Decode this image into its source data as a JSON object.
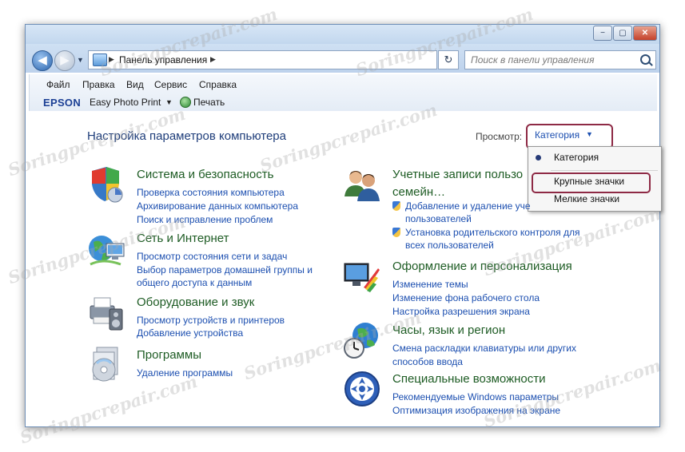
{
  "window": {
    "minimize": "−",
    "maximize": "▢",
    "close": "✕"
  },
  "address": {
    "location": "Панель управления",
    "breadcrumb_arrow": "▶",
    "search_placeholder": "Поиск в панели управления"
  },
  "menu": [
    "Файл",
    "Правка",
    "Вид",
    "Сервис",
    "Справка"
  ],
  "toolbar": {
    "epson": "EPSON",
    "easy_photo_print": "Easy Photo Print",
    "print": "Печать"
  },
  "header": {
    "title": "Настройка параметров компьютера",
    "view_label": "Просмотр:",
    "view_value": "Категория"
  },
  "view_menu": {
    "items": [
      "Категория",
      "Крупные значки",
      "Мелкие значки"
    ],
    "selected": "Категория"
  },
  "categories_left": [
    {
      "icon": "shield-icon",
      "title": "Система и безопасность",
      "links": [
        "Проверка состояния компьютера",
        "Архивирование данных компьютера",
        "Поиск и исправление проблем"
      ]
    },
    {
      "icon": "network-globe-icon",
      "title": "Сеть и Интернет",
      "links": [
        "Просмотр состояния сети и задач",
        "Выбор параметров домашней группы и",
        "общего доступа к данным"
      ]
    },
    {
      "icon": "printer-speaker-icon",
      "title": "Оборудование и звук",
      "links": [
        "Просмотр устройств и принтеров",
        "Добавление устройства"
      ]
    },
    {
      "icon": "programs-disc-icon",
      "title": "Программы",
      "links": [
        "Удаление программы"
      ]
    }
  ],
  "categories_right": [
    {
      "icon": "users-icon",
      "title": "Учетные записи пользо",
      "title2": "семейн…",
      "links": [
        "Добавление и удаление уче",
        "пользователей",
        "Установка родительского контроля для",
        "всех пользователей"
      ]
    },
    {
      "icon": "appearance-monitor-icon",
      "title": "Оформление и персонализация",
      "links": [
        "Изменение темы",
        "Изменение фона рабочего стола",
        "Настройка разрешения экрана"
      ]
    },
    {
      "icon": "clock-globe-icon",
      "title": "Часы, язык и регион",
      "links": [
        "Смена раскладки клавиатуры или других",
        "способов ввода"
      ]
    },
    {
      "icon": "accessibility-icon",
      "title": "Специальные возможности",
      "links": [
        "Рекомендуемые Windows параметры",
        "Оптимизация изображения на экране"
      ]
    }
  ],
  "watermark": "Soringpcrepair.com",
  "colors": {
    "link": "#1c4fb0",
    "category_title": "#1e5c24",
    "heading": "#1e3d7a",
    "highlight_border": "#8e2a45"
  }
}
